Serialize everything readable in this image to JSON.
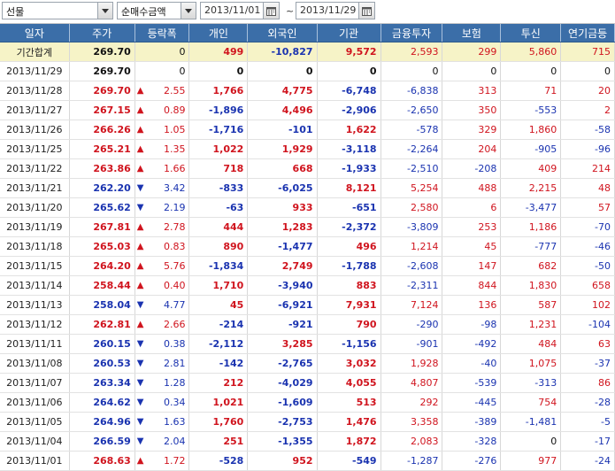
{
  "toolbar": {
    "market_select": "선물",
    "type_select": "순매수금액",
    "start_date": "2013/11/01",
    "separator": "~",
    "end_date": "2013/11/29"
  },
  "columns": [
    "일자",
    "주가",
    "등락폭",
    "개인",
    "외국인",
    "기관",
    "금융투자",
    "보험",
    "투신",
    "연기금등"
  ],
  "total_row": {
    "label": "기간합계",
    "price": "269.70",
    "change": "0",
    "individual": "499",
    "foreign": "-10,827",
    "institution": "9,572",
    "fin_invest": "2,593",
    "insurance": "299",
    "trust": "5,860",
    "pension": "715"
  },
  "rows": [
    {
      "date": "2013/11/29",
      "price": "269.70",
      "dir": "none",
      "change": "0",
      "individual": "0",
      "foreign": "0",
      "institution": "0",
      "fin_invest": "0",
      "insurance": "0",
      "trust": "0",
      "pension": "0"
    },
    {
      "date": "2013/11/28",
      "price": "269.70",
      "dir": "up",
      "change": "2.55",
      "individual": "1,766",
      "foreign": "4,775",
      "institution": "-6,748",
      "fin_invest": "-6,838",
      "insurance": "313",
      "trust": "71",
      "pension": "20"
    },
    {
      "date": "2013/11/27",
      "price": "267.15",
      "dir": "up",
      "change": "0.89",
      "individual": "-1,896",
      "foreign": "4,496",
      "institution": "-2,906",
      "fin_invest": "-2,650",
      "insurance": "350",
      "trust": "-553",
      "pension": "2"
    },
    {
      "date": "2013/11/26",
      "price": "266.26",
      "dir": "up",
      "change": "1.05",
      "individual": "-1,716",
      "foreign": "-101",
      "institution": "1,622",
      "fin_invest": "-578",
      "insurance": "329",
      "trust": "1,860",
      "pension": "-58"
    },
    {
      "date": "2013/11/25",
      "price": "265.21",
      "dir": "up",
      "change": "1.35",
      "individual": "1,022",
      "foreign": "1,929",
      "institution": "-3,118",
      "fin_invest": "-2,264",
      "insurance": "204",
      "trust": "-905",
      "pension": "-96"
    },
    {
      "date": "2013/11/22",
      "price": "263.86",
      "dir": "up",
      "change": "1.66",
      "individual": "718",
      "foreign": "668",
      "institution": "-1,933",
      "fin_invest": "-2,510",
      "insurance": "-208",
      "trust": "409",
      "pension": "214"
    },
    {
      "date": "2013/11/21",
      "price": "262.20",
      "dir": "down",
      "change": "3.42",
      "individual": "-833",
      "foreign": "-6,025",
      "institution": "8,121",
      "fin_invest": "5,254",
      "insurance": "488",
      "trust": "2,215",
      "pension": "48"
    },
    {
      "date": "2013/11/20",
      "price": "265.62",
      "dir": "down",
      "change": "2.19",
      "individual": "-63",
      "foreign": "933",
      "institution": "-651",
      "fin_invest": "2,580",
      "insurance": "6",
      "trust": "-3,477",
      "pension": "57"
    },
    {
      "date": "2013/11/19",
      "price": "267.81",
      "dir": "up",
      "change": "2.78",
      "individual": "444",
      "foreign": "1,283",
      "institution": "-2,372",
      "fin_invest": "-3,809",
      "insurance": "253",
      "trust": "1,186",
      "pension": "-70"
    },
    {
      "date": "2013/11/18",
      "price": "265.03",
      "dir": "up",
      "change": "0.83",
      "individual": "890",
      "foreign": "-1,477",
      "institution": "496",
      "fin_invest": "1,214",
      "insurance": "45",
      "trust": "-777",
      "pension": "-46"
    },
    {
      "date": "2013/11/15",
      "price": "264.20",
      "dir": "up",
      "change": "5.76",
      "individual": "-1,834",
      "foreign": "2,749",
      "institution": "-1,788",
      "fin_invest": "-2,608",
      "insurance": "147",
      "trust": "682",
      "pension": "-50"
    },
    {
      "date": "2013/11/14",
      "price": "258.44",
      "dir": "up",
      "change": "0.40",
      "individual": "1,710",
      "foreign": "-3,940",
      "institution": "883",
      "fin_invest": "-2,311",
      "insurance": "844",
      "trust": "1,830",
      "pension": "658"
    },
    {
      "date": "2013/11/13",
      "price": "258.04",
      "dir": "down",
      "change": "4.77",
      "individual": "45",
      "foreign": "-6,921",
      "institution": "7,931",
      "fin_invest": "7,124",
      "insurance": "136",
      "trust": "587",
      "pension": "102"
    },
    {
      "date": "2013/11/12",
      "price": "262.81",
      "dir": "up",
      "change": "2.66",
      "individual": "-214",
      "foreign": "-921",
      "institution": "790",
      "fin_invest": "-290",
      "insurance": "-98",
      "trust": "1,231",
      "pension": "-104"
    },
    {
      "date": "2013/11/11",
      "price": "260.15",
      "dir": "down",
      "change": "0.38",
      "individual": "-2,112",
      "foreign": "3,285",
      "institution": "-1,156",
      "fin_invest": "-901",
      "insurance": "-492",
      "trust": "484",
      "pension": "63"
    },
    {
      "date": "2013/11/08",
      "price": "260.53",
      "dir": "down",
      "change": "2.81",
      "individual": "-142",
      "foreign": "-2,765",
      "institution": "3,032",
      "fin_invest": "1,928",
      "insurance": "-40",
      "trust": "1,075",
      "pension": "-37"
    },
    {
      "date": "2013/11/07",
      "price": "263.34",
      "dir": "down",
      "change": "1.28",
      "individual": "212",
      "foreign": "-4,029",
      "institution": "4,055",
      "fin_invest": "4,807",
      "insurance": "-539",
      "trust": "-313",
      "pension": "86"
    },
    {
      "date": "2013/11/06",
      "price": "264.62",
      "dir": "down",
      "change": "0.34",
      "individual": "1,021",
      "foreign": "-1,609",
      "institution": "513",
      "fin_invest": "292",
      "insurance": "-445",
      "trust": "754",
      "pension": "-28"
    },
    {
      "date": "2013/11/05",
      "price": "264.96",
      "dir": "down",
      "change": "1.63",
      "individual": "1,760",
      "foreign": "-2,753",
      "institution": "1,476",
      "fin_invest": "3,358",
      "insurance": "-389",
      "trust": "-1,481",
      "pension": "-5"
    },
    {
      "date": "2013/11/04",
      "price": "266.59",
      "dir": "down",
      "change": "2.04",
      "individual": "251",
      "foreign": "-1,355",
      "institution": "1,872",
      "fin_invest": "2,083",
      "insurance": "-328",
      "trust": "0",
      "pension": "-17"
    },
    {
      "date": "2013/11/01",
      "price": "268.63",
      "dir": "up",
      "change": "1.72",
      "individual": "-528",
      "foreign": "952",
      "institution": "-549",
      "fin_invest": "-1,287",
      "insurance": "-276",
      "trust": "977",
      "pension": "-24"
    }
  ],
  "colors": {
    "header_bg": "#3b6ea8",
    "total_bg": "#f6f3c7",
    "up": "#d0141e",
    "down": "#1a33b0"
  },
  "icons": {
    "up": "triangle-up-icon",
    "down": "triangle-down-icon",
    "calendar": "calendar-icon"
  }
}
